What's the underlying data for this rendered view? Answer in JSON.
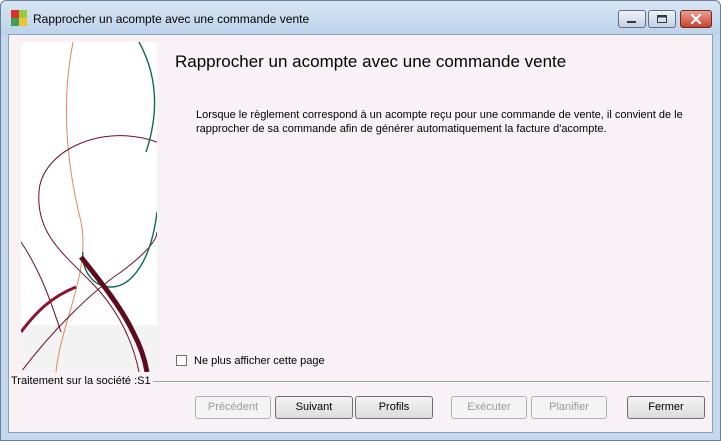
{
  "window": {
    "title": "Rapprocher un acompte avec une commande vente",
    "icon": "app-icon",
    "controls": [
      "minimize-icon",
      "maximize-icon",
      "close-icon"
    ]
  },
  "page": {
    "heading": "Rapprocher un acompte avec une commande vente",
    "description_line1": "Lorsque le règlement correspond à un acompte reçu pour une commande de vente, il convient de le",
    "description_line2": "rapprocher de sa commande afin de générer automatiquement la facture d'acompte.",
    "checkbox_label": "Ne plus afficher cette page",
    "checkbox_checked": false,
    "company_label": "Traitement sur la société :S1"
  },
  "buttons": {
    "previous": "Précédent",
    "next": "Suivant",
    "profiles": "Profils",
    "execute": "Exécuter",
    "schedule": "Planifier",
    "close": "Fermer"
  },
  "colors": {
    "title_bar": "#c6d8ec",
    "client_bg": "#f8f2f6",
    "banner_wine": "#6b0f24",
    "banner_green": "#0e6b4f",
    "banner_orange": "#d98a5c"
  }
}
